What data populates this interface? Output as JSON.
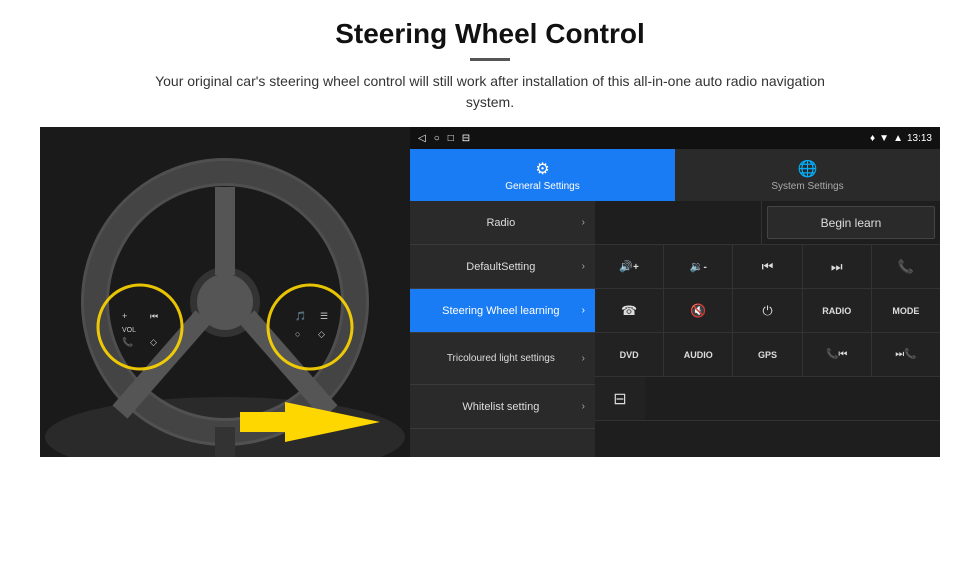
{
  "header": {
    "title": "Steering Wheel Control",
    "divider": true,
    "subtitle": "Your original car's steering wheel control will still work after installation of this all-in-one auto radio navigation system."
  },
  "status_bar": {
    "nav_back": "◁",
    "nav_home": "○",
    "nav_square": "□",
    "nav_menu": "⊟",
    "signal_icon": "▼",
    "wifi_icon": "▲",
    "time": "13:13",
    "location_icon": "♦"
  },
  "tabs": [
    {
      "id": "general",
      "label": "General Settings",
      "active": true
    },
    {
      "id": "system",
      "label": "System Settings",
      "active": false
    }
  ],
  "menu_items": [
    {
      "id": "radio",
      "label": "Radio",
      "active": false
    },
    {
      "id": "default",
      "label": "DefaultSetting",
      "active": false
    },
    {
      "id": "steering",
      "label": "Steering Wheel learning",
      "active": true
    },
    {
      "id": "tricoloured",
      "label": "Tricoloured light settings",
      "active": false
    },
    {
      "id": "whitelist",
      "label": "Whitelist setting",
      "active": false
    }
  ],
  "controls": {
    "begin_learn": "Begin learn",
    "row1": [
      {
        "id": "vol-up",
        "symbol": "🔊+",
        "text": "vol+"
      },
      {
        "id": "vol-down",
        "symbol": "🔉-",
        "text": "vol-"
      },
      {
        "id": "prev-track",
        "symbol": "⏮",
        "text": "prev"
      },
      {
        "id": "next-track",
        "symbol": "⏭",
        "text": "next"
      },
      {
        "id": "phone",
        "symbol": "📞",
        "text": "call"
      }
    ],
    "row2": [
      {
        "id": "pickup",
        "symbol": "☎",
        "text": "pickup"
      },
      {
        "id": "mute",
        "symbol": "🔇",
        "text": "mute"
      },
      {
        "id": "power",
        "symbol": "⏻",
        "text": "power"
      },
      {
        "id": "radio-btn",
        "symbol": "RADIO",
        "text": ""
      },
      {
        "id": "mode",
        "symbol": "MODE",
        "text": ""
      }
    ],
    "row3": [
      {
        "id": "dvd",
        "symbol": "DVD",
        "text": ""
      },
      {
        "id": "audio",
        "symbol": "AUDIO",
        "text": ""
      },
      {
        "id": "gps",
        "symbol": "GPS",
        "text": ""
      },
      {
        "id": "tel-prev",
        "symbol": "📞⏮",
        "text": ""
      },
      {
        "id": "tel-next",
        "symbol": "⏭📞",
        "text": ""
      }
    ],
    "row4_icon": "⊟"
  }
}
